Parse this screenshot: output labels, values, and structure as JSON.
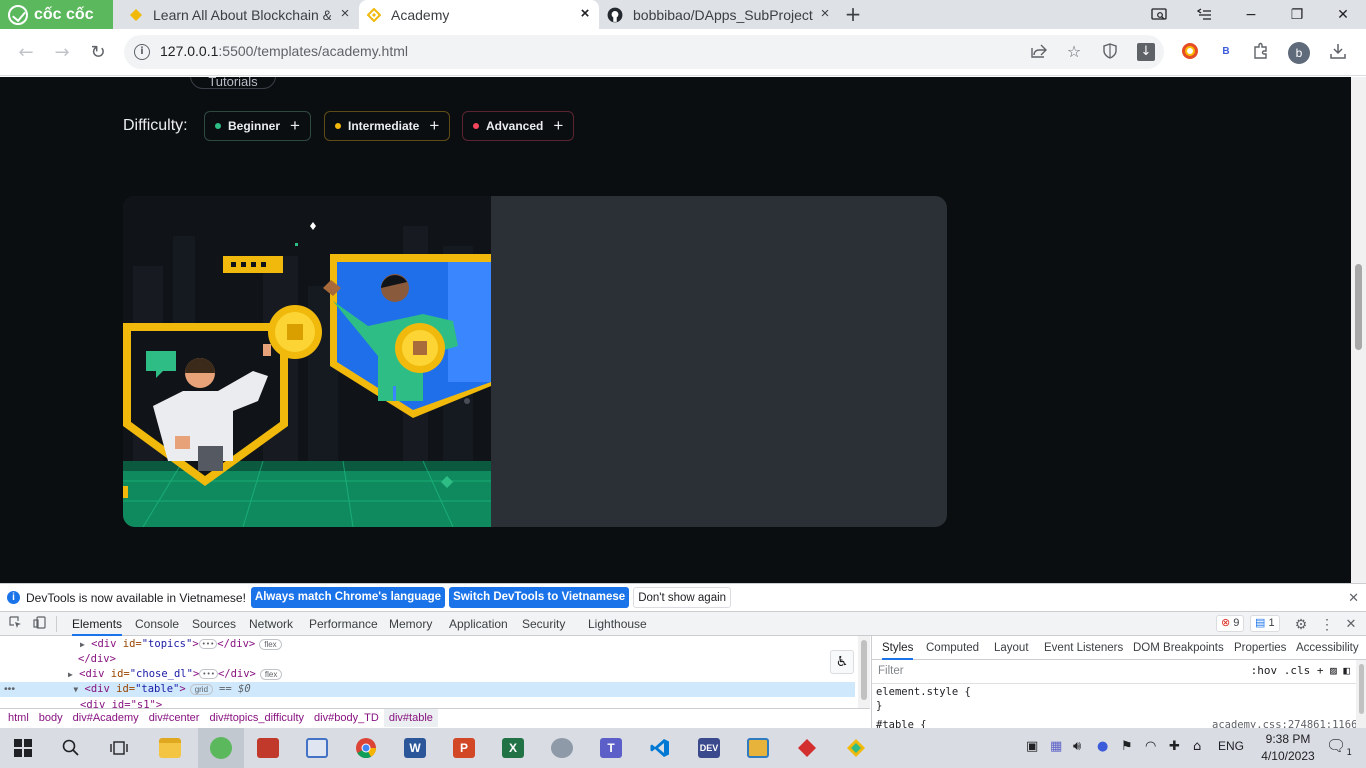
{
  "browser": {
    "brand_label": "cốc cốc",
    "tabs": [
      {
        "title": "Learn All About Blockchain &",
        "close": "×"
      },
      {
        "title": "Academy",
        "close": "×"
      },
      {
        "title": "bobbibao/DApps_SubProject",
        "close": "×"
      }
    ],
    "new_tab": "+",
    "window_controls": {
      "minimize": "−",
      "maximize": "❐",
      "close": "✕"
    },
    "url_host": "127.0.0.1",
    "url_path": ":5500/templates/academy.html",
    "avatar_letter": "b",
    "extension_b": "B"
  },
  "page": {
    "tutorials_label": "Tutorials",
    "difficulty_label": "Difficulty:",
    "chips": [
      {
        "label": "Beginner",
        "color": "#2ebd85"
      },
      {
        "label": "Intermediate",
        "color": "#f0b90b"
      },
      {
        "label": "Advanced",
        "color": "#f6465d"
      }
    ],
    "chip_plus": "+"
  },
  "devtools": {
    "infobar_message": "DevTools is now available in Vietnamese!",
    "btn_match": "Always match Chrome's language",
    "btn_switch": "Switch DevTools to Vietnamese",
    "btn_dont_show": "Don't show again",
    "tabs": [
      "Elements",
      "Console",
      "Sources",
      "Network",
      "Performance",
      "Memory",
      "Application",
      "Security",
      "Lighthouse"
    ],
    "error_count": "9",
    "message_count": "1",
    "code": {
      "line1_tag": "<div ",
      "line1_attr": "id=",
      "line1_val": "\"topics\"",
      "line1_end": "></div>",
      "line1_pill": "flex",
      "line2": "</div>",
      "line3_tag": "<div ",
      "line3_attr": "id=",
      "line3_val": "\"chose_dl\"",
      "line3_end": "></div>",
      "line3_pill": "flex",
      "line4_tag": "<div ",
      "line4_attr": "id=",
      "line4_val": "\"table\"",
      "line4_end": ">",
      "line4_pill": "grid",
      "line4_eq": "== $0",
      "line5": "<div id=\"s1\">"
    },
    "breadcrumbs": [
      "html",
      "body",
      "div#Academy",
      "div#center",
      "div#topics_difficulty",
      "div#body_TD",
      "div#table"
    ],
    "styles_tabs": [
      "Styles",
      "Computed",
      "Layout",
      "Event Listeners",
      "DOM Breakpoints",
      "Properties",
      "Accessibility"
    ],
    "filter_placeholder": "Filter",
    "filter_tools": ":hov  .cls  +",
    "rule_element_style": "element.style {",
    "rule_close": "}",
    "rule_table": "#table {",
    "rule_source": "academy.css:274861:1166"
  },
  "taskbar": {
    "language": "ENG",
    "time": "9:38 PM",
    "date": "4/10/2023",
    "notifications": "1"
  }
}
